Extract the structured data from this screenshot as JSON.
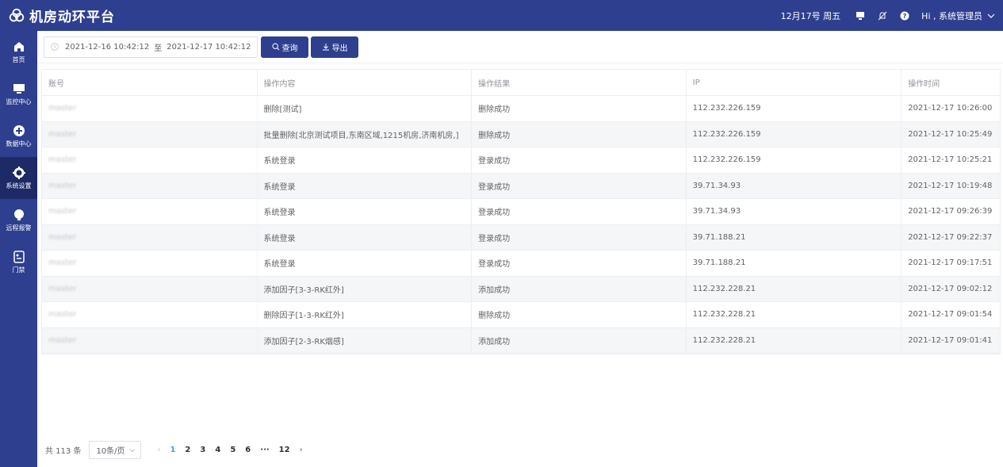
{
  "app": {
    "title": "机房动环平台",
    "date": "12月17号 周五",
    "user": "Hi , 系统管理员"
  },
  "sidebar": {
    "items": [
      {
        "label": "首页",
        "icon": "home-icon"
      },
      {
        "label": "监控中心",
        "icon": "monitor-icon"
      },
      {
        "label": "数据中心",
        "icon": "data-icon"
      },
      {
        "label": "系统设置",
        "icon": "gear-icon"
      },
      {
        "label": "远程报警",
        "icon": "alarm-icon"
      },
      {
        "label": "门禁",
        "icon": "door-icon"
      }
    ]
  },
  "toolbar": {
    "start": "2021-12-16 10:42:12",
    "sep": "至",
    "end": "2021-12-17 10:42:12",
    "query": "查询",
    "export": "导出"
  },
  "table": {
    "headers": [
      "账号",
      "操作内容",
      "操作结果",
      "IP",
      "操作时间"
    ],
    "rows": [
      [
        "master",
        "删除[测试]",
        "删除成功",
        "112.232.226.159",
        "2021-12-17 10:26:00"
      ],
      [
        "master",
        "批量删除[北京测试项目,东南区域,1215机房,济南机房,]",
        "删除成功",
        "112.232.226.159",
        "2021-12-17 10:25:49"
      ],
      [
        "master",
        "系统登录",
        "登录成功",
        "112.232.226.159",
        "2021-12-17 10:25:21"
      ],
      [
        "master",
        "系统登录",
        "登录成功",
        "39.71.34.93",
        "2021-12-17 10:19:48"
      ],
      [
        "master",
        "系统登录",
        "登录成功",
        "39.71.34.93",
        "2021-12-17 09:26:39"
      ],
      [
        "master",
        "系统登录",
        "登录成功",
        "39.71.188.21",
        "2021-12-17 09:22:37"
      ],
      [
        "master",
        "系统登录",
        "登录成功",
        "39.71.188.21",
        "2021-12-17 09:17:51"
      ],
      [
        "master",
        "添加因子[3-3-RK红外]",
        "添加成功",
        "112.232.228.21",
        "2021-12-17 09:02:12"
      ],
      [
        "master",
        "删除因子[1-3-RK红外]",
        "删除成功",
        "112.232.228.21",
        "2021-12-17 09:01:54"
      ],
      [
        "master",
        "添加因子[2-3-RK烟感]",
        "添加成功",
        "112.232.228.21",
        "2021-12-17 09:01:41"
      ]
    ]
  },
  "pager": {
    "total": "共 113 条",
    "size": "10条/页",
    "pages": [
      "1",
      "2",
      "3",
      "4",
      "5",
      "6",
      "···",
      "12"
    ],
    "active": "1"
  },
  "colors": {
    "brand": "#2e3f8f",
    "active_page": "#409eff"
  }
}
